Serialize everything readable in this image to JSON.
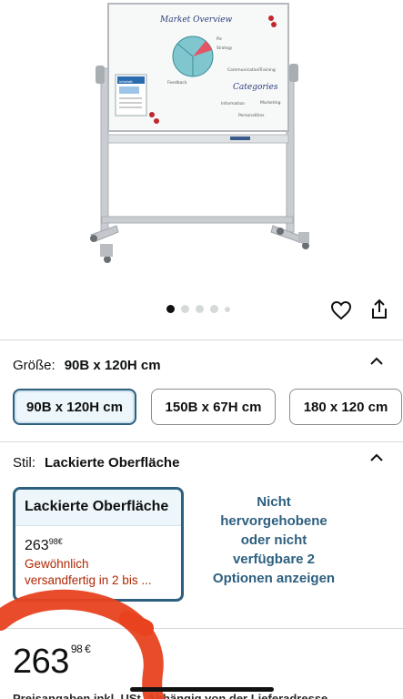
{
  "hero": {
    "board_heading": "Market Overview",
    "board_word_categories": "Categories",
    "board_notes": [
      "Communication",
      "Training",
      "Information",
      "Marketing",
      "Personalities"
    ],
    "board_side_notes": [
      "Pie",
      "Strategy",
      "Feedback"
    ],
    "poster_title": "Infoblatt"
  },
  "carousel": {
    "total_dots": 5,
    "active_index": 0
  },
  "size": {
    "label": "Größe:",
    "selected": "90B x 120H cm",
    "options": [
      "90B x 120H cm",
      "150B x 67H cm",
      "180 x 120 cm"
    ]
  },
  "style": {
    "label": "Stil:",
    "selected": "Lackierte Oberfläche",
    "card": {
      "title": "Lackierte Oberfläche",
      "price_whole": "263",
      "price_fraction": "98",
      "currency": "€",
      "shipping_line1": "Gewöhnlich",
      "shipping_line2": "versandfertig in 2 bis ..."
    },
    "more_options": "Nicht hervorgehobene oder nicht verfügbare 2 Optionen anzeigen"
  },
  "price": {
    "whole": "263",
    "fraction": "98",
    "currency": "€"
  },
  "bottom_text": "Preisangaben inkl. USt. Abhängig von der Lieferadresse",
  "colors": {
    "accent": "#2d5f7f",
    "accent_bg": "#edf6fa",
    "price_red": "#b12704",
    "annotation": "#e8421f"
  }
}
